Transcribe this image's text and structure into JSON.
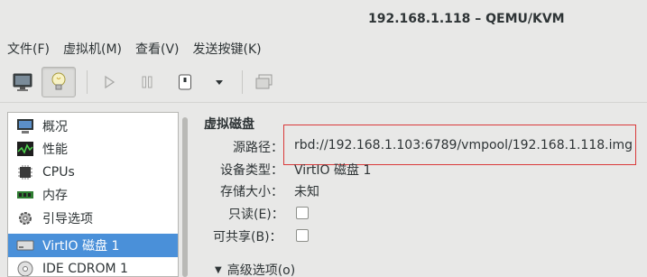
{
  "window": {
    "title": "192.168.1.118 – QEMU/KVM"
  },
  "menubar": {
    "items": [
      "文件(F)",
      "虚拟机(M)",
      "查看(V)",
      "发送按键(K)"
    ]
  },
  "toolbar": {
    "buttons": [
      {
        "icon": "monitor-icon",
        "state": "normal"
      },
      {
        "icon": "lightbulb-icon",
        "state": "active"
      },
      {
        "icon": "play-icon",
        "state": "disabled"
      },
      {
        "icon": "pause-icon",
        "state": "disabled"
      },
      {
        "icon": "power-icon",
        "state": "normal"
      },
      {
        "icon": "dropdown-arrow-icon",
        "state": "normal"
      },
      {
        "icon": "fullscreen-icon",
        "state": "disabled"
      }
    ]
  },
  "sidebar": {
    "items": [
      {
        "label": "概况",
        "icon": "overview-monitor-icon",
        "selected": false
      },
      {
        "label": "性能",
        "icon": "performance-chart-icon",
        "selected": false
      },
      {
        "label": "CPUs",
        "icon": "cpu-chip-icon",
        "selected": false
      },
      {
        "label": "内存",
        "icon": "memory-module-icon",
        "selected": false
      },
      {
        "label": "引导选项",
        "icon": "boot-gear-icon",
        "selected": false
      },
      {
        "label": "VirtIO 磁盘 1",
        "icon": "hard-disk-icon",
        "selected": true
      },
      {
        "label": "IDE CDROM 1",
        "icon": "cdrom-icon",
        "selected": false
      }
    ]
  },
  "detail": {
    "heading": "虚拟磁盘",
    "source_path_label": "源路径：",
    "source_path_value": "rbd://192.168.1.103:6789/vmpool/192.168.1.118.img",
    "device_type_label": "设备类型：",
    "device_type_value": "VirtIO 磁盘 1",
    "storage_size_label": "存储大小：",
    "storage_size_value": "未知",
    "readonly_label": "只读(E)：",
    "shareable_label": "可共享(B)：",
    "advanced_label": "高级选项(o)"
  },
  "colors": {
    "selection": "#4a90d9",
    "highlight_box": "#d93a3a"
  }
}
